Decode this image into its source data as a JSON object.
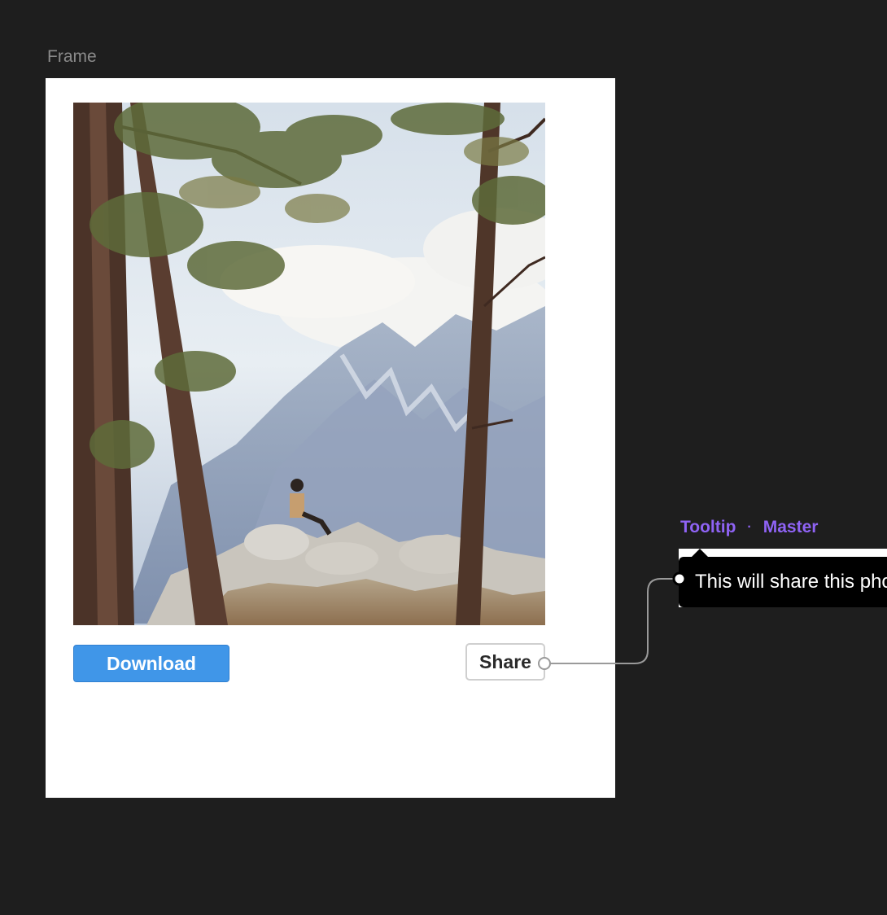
{
  "frame": {
    "label": "Frame"
  },
  "photo": {
    "description_icon": "photo-image"
  },
  "buttons": {
    "download_label": "Download",
    "share_label": "Share"
  },
  "component": {
    "name": "Tooltip",
    "separator": "·",
    "variant": "Master"
  },
  "tooltip": {
    "text": "This will share this photo"
  },
  "colors": {
    "canvas": "#1e1e1e",
    "download_bg": "#4096e8",
    "component_label": "#8f63f5",
    "tooltip_bg": "#000000"
  }
}
